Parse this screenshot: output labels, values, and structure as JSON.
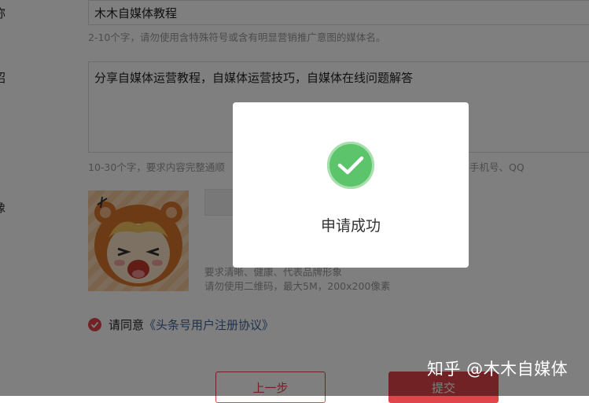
{
  "form": {
    "name_label": "称",
    "name_value": "木木自媒体教程",
    "name_hint": "2-10个字，请勿使用含特殊符号或含有明显营销推广意图的媒体名。",
    "intro_label": "绍",
    "intro_value": "分享自媒体运营教程，自媒体运营技巧，自媒体在线问题解答",
    "intro_hint": "10-30个字，要求内容完整通顺",
    "intro_hint_tail": "手机号、QQ",
    "avatar_label": "像",
    "avatar_hint_1": "要求清晰、健康、代表品牌形象",
    "avatar_hint_2": "请勿使用二维码，最大5M，200x200像素",
    "agree_text": "请同意",
    "agree_link": "《头条号用户注册协议》",
    "prev_button": "上一步",
    "submit_button": "提交"
  },
  "modal": {
    "message": "申请成功",
    "icon": "checkmark-circle-icon"
  },
  "watermark": "知乎 @木木自媒体",
  "colors": {
    "accent": "#e0454b",
    "success": "#5cc46a",
    "link": "#406599"
  }
}
